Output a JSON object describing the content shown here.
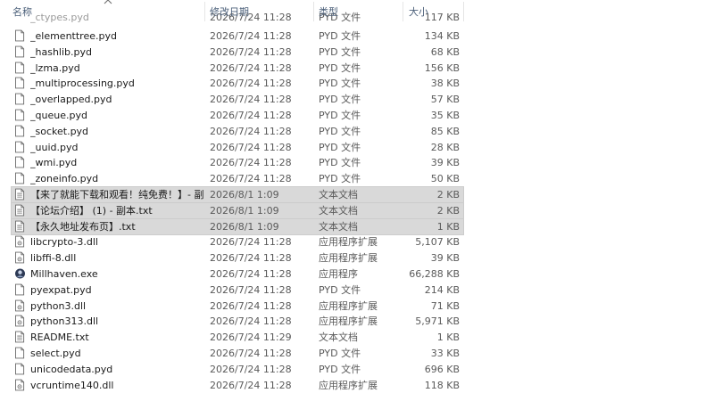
{
  "columns": {
    "name": "名称",
    "date": "修改日期",
    "type": "类型",
    "size": "大小"
  },
  "partial_row": {
    "name": "_ctypes.pyd",
    "date": "2026/7/24 11:28",
    "type": "PYD 文件",
    "size": "117 KB"
  },
  "files": [
    {
      "name": "_elementtree.pyd",
      "date": "2026/7/24 11:28",
      "type": "PYD 文件",
      "size": "134 KB",
      "icon": "file-icon"
    },
    {
      "name": "_hashlib.pyd",
      "date": "2026/7/24 11:28",
      "type": "PYD 文件",
      "size": "68 KB",
      "icon": "file-icon"
    },
    {
      "name": "_lzma.pyd",
      "date": "2026/7/24 11:28",
      "type": "PYD 文件",
      "size": "156 KB",
      "icon": "file-icon"
    },
    {
      "name": "_multiprocessing.pyd",
      "date": "2026/7/24 11:28",
      "type": "PYD 文件",
      "size": "38 KB",
      "icon": "file-icon"
    },
    {
      "name": "_overlapped.pyd",
      "date": "2026/7/24 11:28",
      "type": "PYD 文件",
      "size": "57 KB",
      "icon": "file-icon"
    },
    {
      "name": "_queue.pyd",
      "date": "2026/7/24 11:28",
      "type": "PYD 文件",
      "size": "35 KB",
      "icon": "file-icon"
    },
    {
      "name": "_socket.pyd",
      "date": "2026/7/24 11:28",
      "type": "PYD 文件",
      "size": "85 KB",
      "icon": "file-icon"
    },
    {
      "name": "_uuid.pyd",
      "date": "2026/7/24 11:28",
      "type": "PYD 文件",
      "size": "28 KB",
      "icon": "file-icon"
    },
    {
      "name": "_wmi.pyd",
      "date": "2026/7/24 11:28",
      "type": "PYD 文件",
      "size": "39 KB",
      "icon": "file-icon"
    },
    {
      "name": "_zoneinfo.pyd",
      "date": "2026/7/24 11:28",
      "type": "PYD 文件",
      "size": "50 KB",
      "icon": "file-icon"
    },
    {
      "name": "【来了就能下载和观看！纯免费！】- 副...",
      "date": "2026/8/1 1:09",
      "type": "文本文档",
      "size": "2 KB",
      "icon": "text-file-icon",
      "selected": true
    },
    {
      "name": "【论坛介绍】 (1) - 副本.txt",
      "date": "2026/8/1 1:09",
      "type": "文本文档",
      "size": "2 KB",
      "icon": "text-file-icon",
      "selected": true
    },
    {
      "name": "【永久地址发布页】.txt",
      "date": "2026/8/1 1:09",
      "type": "文本文档",
      "size": "1 KB",
      "icon": "text-file-icon",
      "selected": true
    },
    {
      "name": "libcrypto-3.dll",
      "date": "2026/7/24 11:28",
      "type": "应用程序扩展",
      "size": "5,107 KB",
      "icon": "dll-icon"
    },
    {
      "name": "libffi-8.dll",
      "date": "2026/7/24 11:28",
      "type": "应用程序扩展",
      "size": "39 KB",
      "icon": "dll-icon"
    },
    {
      "name": "Millhaven.exe",
      "date": "2026/7/24 11:28",
      "type": "应用程序",
      "size": "66,288 KB",
      "icon": "app-icon"
    },
    {
      "name": "pyexpat.pyd",
      "date": "2026/7/24 11:28",
      "type": "PYD 文件",
      "size": "214 KB",
      "icon": "file-icon"
    },
    {
      "name": "python3.dll",
      "date": "2026/7/24 11:28",
      "type": "应用程序扩展",
      "size": "71 KB",
      "icon": "dll-icon"
    },
    {
      "name": "python313.dll",
      "date": "2026/7/24 11:28",
      "type": "应用程序扩展",
      "size": "5,971 KB",
      "icon": "dll-icon"
    },
    {
      "name": "README.txt",
      "date": "2026/7/24 11:29",
      "type": "文本文档",
      "size": "1 KB",
      "icon": "text-file-icon"
    },
    {
      "name": "select.pyd",
      "date": "2026/7/24 11:28",
      "type": "PYD 文件",
      "size": "33 KB",
      "icon": "file-icon"
    },
    {
      "name": "unicodedata.pyd",
      "date": "2026/7/24 11:28",
      "type": "PYD 文件",
      "size": "696 KB",
      "icon": "file-icon"
    },
    {
      "name": "vcruntime140.dll",
      "date": "2026/7/24 11:28",
      "type": "应用程序扩展",
      "size": "118 KB",
      "icon": "dll-icon"
    }
  ]
}
